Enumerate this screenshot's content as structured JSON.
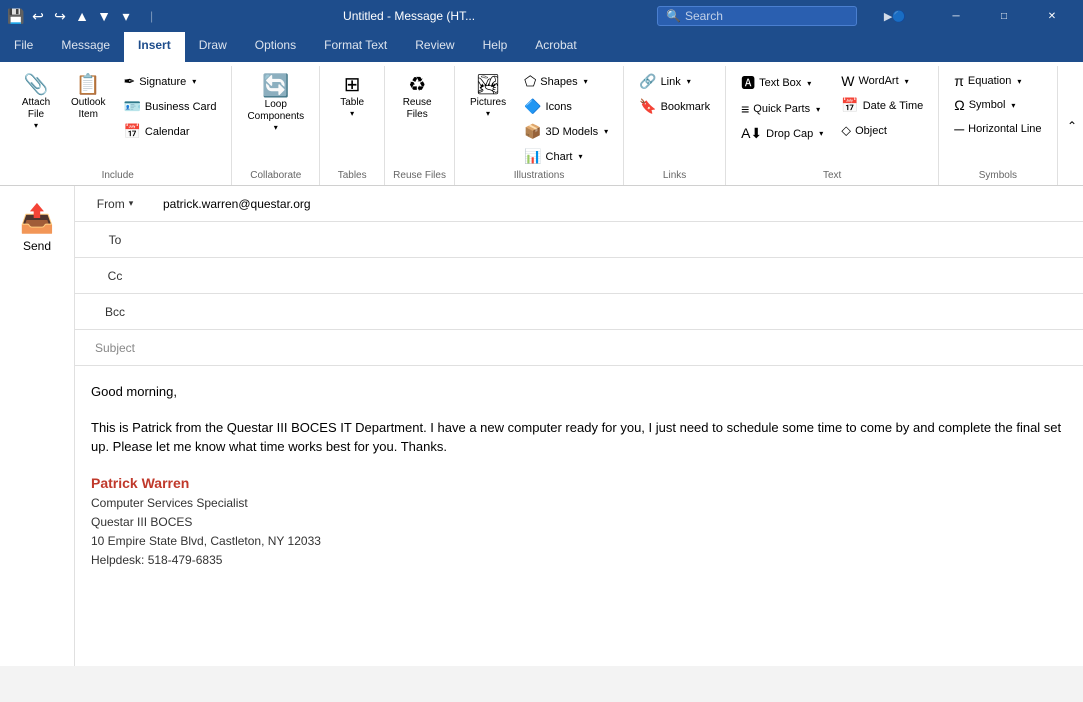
{
  "titlebar": {
    "quick_access": [
      "save",
      "undo",
      "redo",
      "up",
      "down",
      "more"
    ],
    "title": "Untitled - Message (HT...",
    "search_placeholder": "Search",
    "window_controls": [
      "minimize",
      "maximize",
      "close"
    ]
  },
  "ribbon": {
    "tabs": [
      "File",
      "Message",
      "Insert",
      "Draw",
      "Options",
      "Format Text",
      "Review",
      "Help",
      "Acrobat"
    ],
    "active_tab": "Insert",
    "groups": [
      {
        "label": "Include",
        "items": [
          {
            "icon": "📎",
            "label": "Attach\nFile",
            "type": "large-dropdown"
          },
          {
            "icon": "🗒",
            "label": "Outlook\nItem",
            "type": "large-dropdown"
          },
          {
            "icon": "🔗",
            "label": "",
            "type": "small-stack"
          }
        ]
      },
      {
        "label": "Collaborate",
        "items": [
          {
            "icon": "🔄",
            "label": "Loop\nComponents",
            "type": "large-dropdown"
          }
        ]
      },
      {
        "label": "Tables",
        "items": [
          {
            "icon": "⊞",
            "label": "Table",
            "type": "large-dropdown"
          }
        ]
      },
      {
        "label": "Reuse Files",
        "items": [
          {
            "icon": "♻",
            "label": "Reuse\nFiles",
            "type": "large"
          }
        ]
      },
      {
        "label": "Illustrations",
        "items": [
          {
            "icon": "🖼",
            "label": "Pictures",
            "type": "large"
          },
          {
            "icon": "⬠",
            "label": "Shapes ▾",
            "type": "small-stack"
          },
          {
            "icon": "🔷",
            "label": "Icons",
            "type": "small-stack"
          },
          {
            "icon": "📦",
            "label": "3D Models ▾",
            "type": "small-stack"
          },
          {
            "icon": "📊",
            "label": "",
            "type": "small-stack"
          }
        ]
      },
      {
        "label": "Links",
        "items": [
          {
            "icon": "🔗",
            "label": "Link ▾",
            "type": "small-stack"
          },
          {
            "icon": "🔖",
            "label": "Bookmark",
            "type": "small-stack"
          }
        ]
      },
      {
        "label": "Text",
        "items": [
          {
            "icon": "A",
            "label": "Text Box ▾",
            "type": "small-stack"
          },
          {
            "icon": "≡",
            "label": "Quick Parts ▾",
            "type": "small-stack"
          },
          {
            "icon": "A⬇",
            "label": "Drop Cap ▾",
            "type": "small-stack"
          },
          {
            "icon": "W",
            "label": "WordArt ▾",
            "type": "small-stack"
          },
          {
            "icon": "⬦",
            "label": "Object",
            "type": "small-stack"
          },
          {
            "icon": "📅",
            "label": "Date & Time",
            "type": "small-stack"
          }
        ]
      },
      {
        "label": "Symbols",
        "items": [
          {
            "icon": "π",
            "label": "Equation ▾",
            "type": "small-stack"
          },
          {
            "icon": "Ω",
            "label": "Symbol ▾",
            "type": "small-stack"
          },
          {
            "icon": "─",
            "label": "Horizontal Line",
            "type": "small-stack"
          }
        ]
      }
    ]
  },
  "compose": {
    "send_label": "Send",
    "fields": {
      "from": {
        "label": "From",
        "value": "patrick.warren@questar.org"
      },
      "to": {
        "label": "To",
        "value": ""
      },
      "cc": {
        "label": "Cc",
        "value": ""
      },
      "bcc": {
        "label": "Bcc",
        "value": ""
      },
      "subject": {
        "label": "Subject",
        "value": ""
      }
    },
    "body": {
      "greeting": "Good morning,",
      "paragraph": "This is Patrick from the Questar III BOCES IT Department. I have a new computer ready for you, I just need to schedule some time to come by and complete the final set up. Please let me know what time works best for you. Thanks."
    },
    "signature": {
      "name": "Patrick Warren",
      "title": "Computer Services Specialist",
      "org": "Questar III BOCES",
      "address": "10 Empire State Blvd, Castleton, NY 12033",
      "helpdesk": "Helpdesk: 518-479-6835"
    }
  }
}
